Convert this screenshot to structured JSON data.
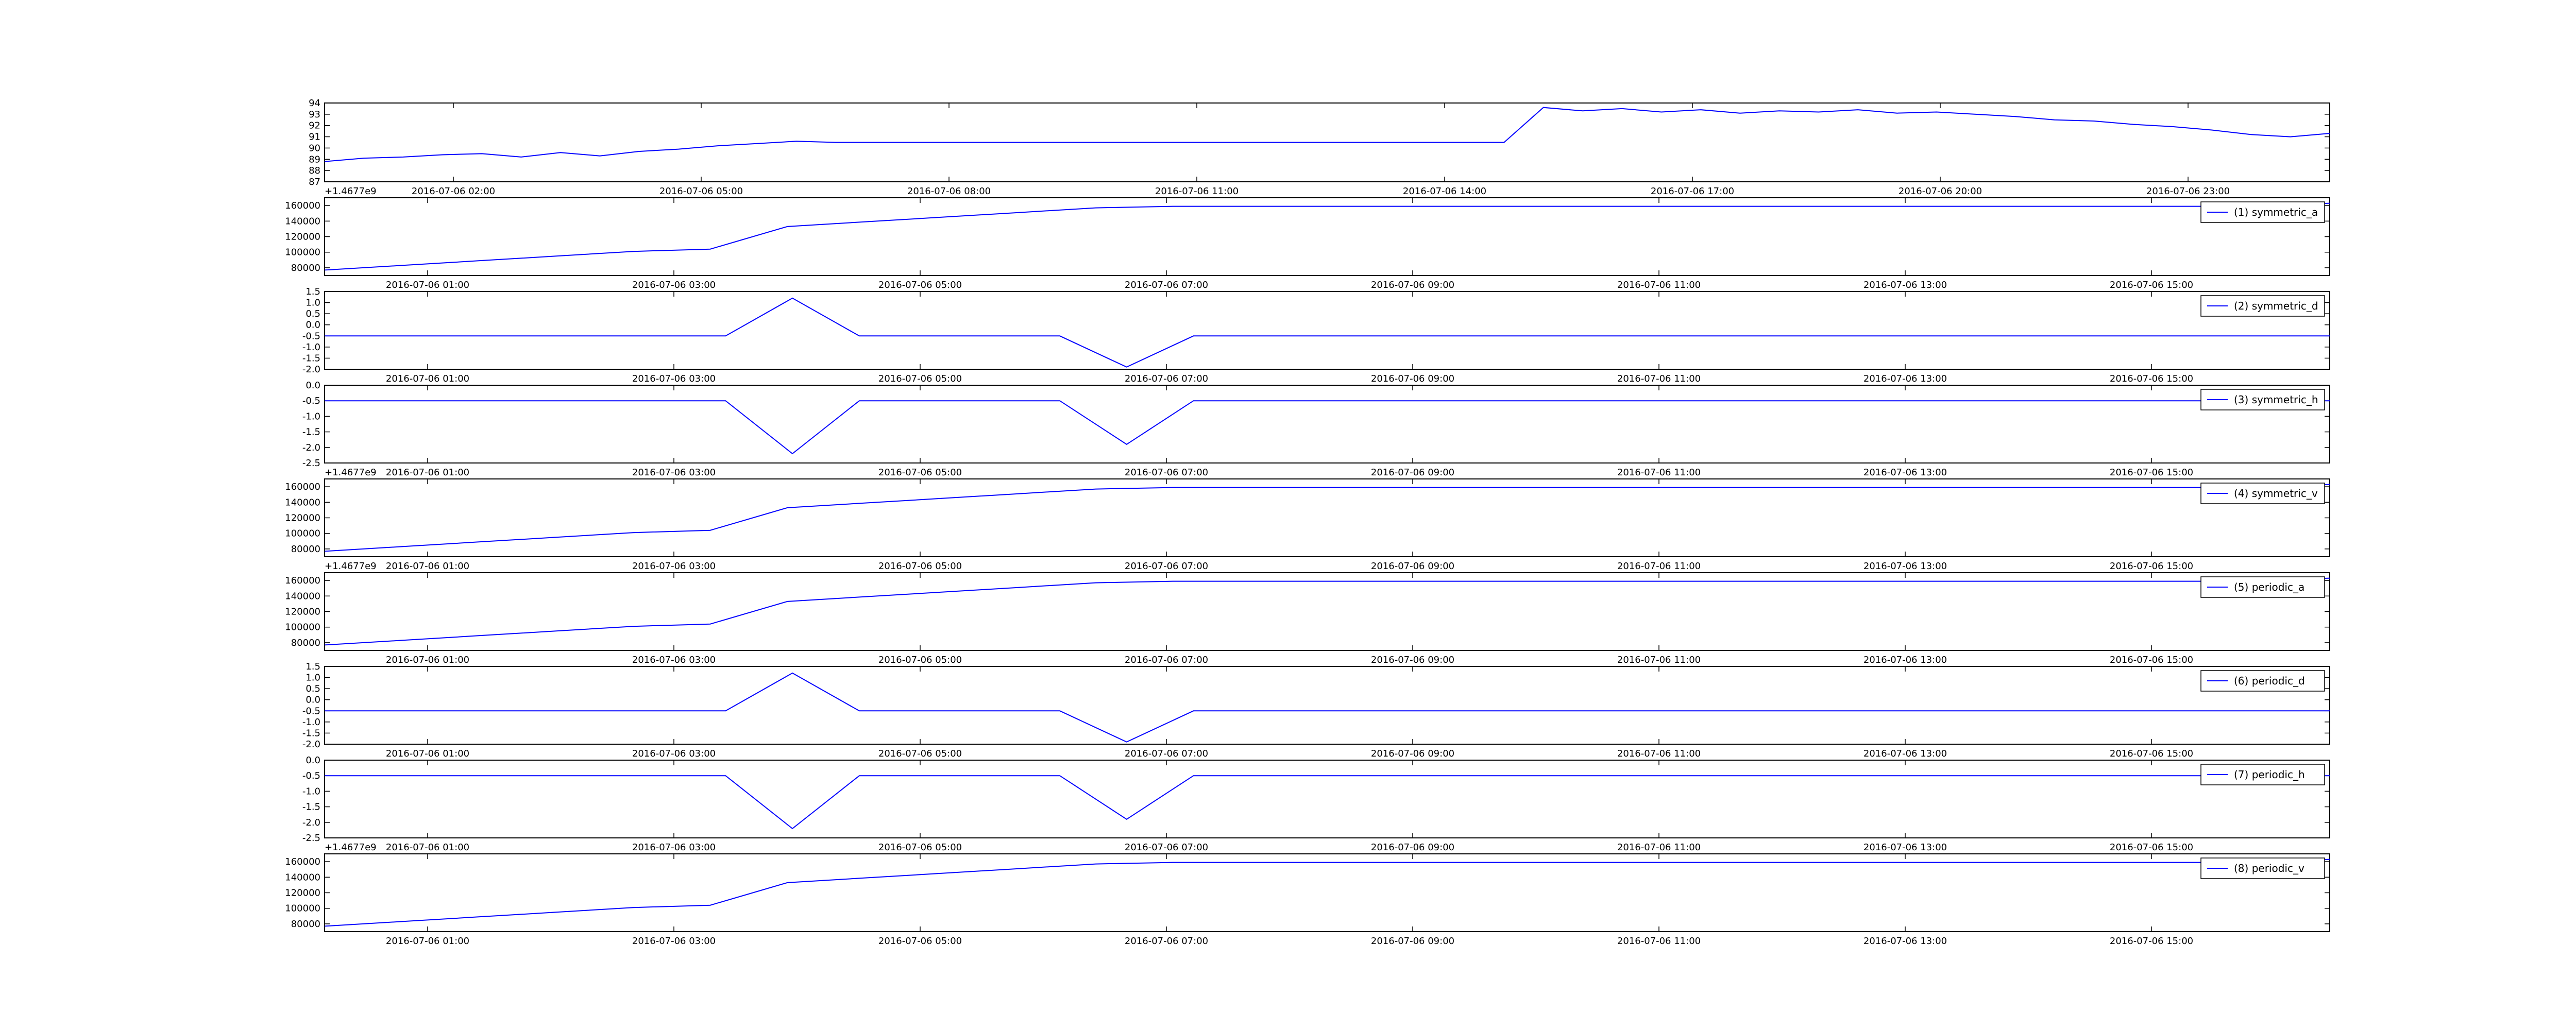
{
  "colors": {
    "line": "#0000ff",
    "axes": "#000000",
    "background": "#ffffff"
  },
  "chart_data": [
    {
      "type": "line",
      "ylim": [
        87,
        94
      ],
      "yticks": [
        "87",
        "88",
        "89",
        "90",
        "91",
        "92",
        "93",
        "94"
      ],
      "xticks": [
        "2016-07-06 02:00",
        "2016-07-06 05:00",
        "2016-07-06 08:00",
        "2016-07-06 11:00",
        "2016-07-06 14:00",
        "2016-07-06 17:00",
        "2016-07-06 20:00",
        "2016-07-06 23:00"
      ],
      "offset_text": "+1.4677e9",
      "series": [
        {
          "values": [
            88.8,
            89.1,
            89.2,
            89.4,
            89.5,
            89.2,
            89.6,
            89.3,
            89.7,
            89.9,
            90.2,
            90.4,
            90.6,
            90.5,
            90.5,
            90.5,
            90.5,
            90.5,
            90.5,
            90.5,
            90.5,
            90.5,
            90.5,
            90.5,
            90.5,
            90.5,
            90.5,
            90.5,
            90.5,
            90.5,
            90.5,
            93.6,
            93.3,
            93.5,
            93.2,
            93.4,
            93.1,
            93.3,
            93.2,
            93.4,
            93.1,
            93.2,
            93.0,
            92.8,
            92.5,
            92.4,
            92.1,
            91.9,
            91.6,
            91.2,
            91.0,
            91.3
          ]
        }
      ]
    },
    {
      "type": "line",
      "ylim": [
        70000,
        170000
      ],
      "yticks": [
        "80000",
        "100000",
        "120000",
        "140000",
        "160000"
      ],
      "xticks": [
        "2016-07-06 01:00",
        "2016-07-06 03:00",
        "2016-07-06 05:00",
        "2016-07-06 07:00",
        "2016-07-06 09:00",
        "2016-07-06 11:00",
        "2016-07-06 13:00",
        "2016-07-06 15:00"
      ],
      "offset_text": "",
      "legend": "(1) symmetric_a",
      "series": [
        {
          "name": "(1) symmetric_a",
          "values": [
            77000,
            83000,
            89000,
            95000,
            101000,
            104000,
            133000,
            139000,
            145000,
            151000,
            157000,
            159000,
            159000,
            159000,
            159000,
            159000,
            159000,
            159000,
            159000,
            159000,
            159000,
            159000,
            159000,
            159000,
            159000,
            159000,
            163000
          ]
        }
      ]
    },
    {
      "type": "line",
      "ylim": [
        -2.0,
        1.5
      ],
      "yticks": [
        "-2.0",
        "-1.5",
        "-1.0",
        "-0.5",
        "0.0",
        "0.5",
        "1.0",
        "1.5"
      ],
      "xticks": [
        "2016-07-06 01:00",
        "2016-07-06 03:00",
        "2016-07-06 05:00",
        "2016-07-06 07:00",
        "2016-07-06 09:00",
        "2016-07-06 11:00",
        "2016-07-06 13:00",
        "2016-07-06 15:00"
      ],
      "offset_text": "",
      "legend": "(2) symmetric_d",
      "series": [
        {
          "name": "(2) symmetric_d",
          "values": [
            -0.5,
            -0.5,
            -0.5,
            -0.5,
            -0.5,
            -0.5,
            -0.5,
            1.2,
            -0.5,
            -0.5,
            -0.5,
            -0.5,
            -1.9,
            -0.5,
            -0.5,
            -0.5,
            -0.5,
            -0.5,
            -0.5,
            -0.5,
            -0.5,
            -0.5,
            -0.5,
            -0.5,
            -0.5,
            -0.5,
            -0.5,
            -0.5,
            -0.5,
            -0.5,
            -0.5
          ]
        }
      ]
    },
    {
      "type": "line",
      "ylim": [
        -2.5,
        0.0
      ],
      "yticks": [
        "-2.5",
        "-2.0",
        "-1.5",
        "-1.0",
        "-0.5",
        "0.0"
      ],
      "xticks": [
        "2016-07-06 01:00",
        "2016-07-06 03:00",
        "2016-07-06 05:00",
        "2016-07-06 07:00",
        "2016-07-06 09:00",
        "2016-07-06 11:00",
        "2016-07-06 13:00",
        "2016-07-06 15:00"
      ],
      "offset_text": "+1.4677e9",
      "legend": "(3) symmetric_h",
      "series": [
        {
          "name": "(3) symmetric_h",
          "values": [
            -0.5,
            -0.5,
            -0.5,
            -0.5,
            -0.5,
            -0.5,
            -0.5,
            -2.2,
            -0.5,
            -0.5,
            -0.5,
            -0.5,
            -1.9,
            -0.5,
            -0.5,
            -0.5,
            -0.5,
            -0.5,
            -0.5,
            -0.5,
            -0.5,
            -0.5,
            -0.5,
            -0.5,
            -0.5,
            -0.5,
            -0.5,
            -0.5,
            -0.5,
            -0.5,
            -0.5
          ]
        }
      ]
    },
    {
      "type": "line",
      "ylim": [
        70000,
        170000
      ],
      "yticks": [
        "80000",
        "100000",
        "120000",
        "140000",
        "160000"
      ],
      "xticks": [
        "2016-07-06 01:00",
        "2016-07-06 03:00",
        "2016-07-06 05:00",
        "2016-07-06 07:00",
        "2016-07-06 09:00",
        "2016-07-06 11:00",
        "2016-07-06 13:00",
        "2016-07-06 15:00"
      ],
      "offset_text": "+1.4677e9",
      "legend": "(4) symmetric_v",
      "series": [
        {
          "name": "(4) symmetric_v",
          "values": [
            77000,
            83000,
            89000,
            95000,
            101000,
            104000,
            133000,
            139000,
            145000,
            151000,
            157000,
            159000,
            159000,
            159000,
            159000,
            159000,
            159000,
            159000,
            159000,
            159000,
            159000,
            159000,
            159000,
            159000,
            159000,
            159000,
            163000
          ]
        }
      ]
    },
    {
      "type": "line",
      "ylim": [
        70000,
        170000
      ],
      "yticks": [
        "80000",
        "100000",
        "120000",
        "140000",
        "160000"
      ],
      "xticks": [
        "2016-07-06 01:00",
        "2016-07-06 03:00",
        "2016-07-06 05:00",
        "2016-07-06 07:00",
        "2016-07-06 09:00",
        "2016-07-06 11:00",
        "2016-07-06 13:00",
        "2016-07-06 15:00"
      ],
      "offset_text": "",
      "legend": "(5) periodic_a",
      "series": [
        {
          "name": "(5) periodic_a",
          "values": [
            77000,
            83000,
            89000,
            95000,
            101000,
            104000,
            133000,
            139000,
            145000,
            151000,
            157000,
            159000,
            159000,
            159000,
            159000,
            159000,
            159000,
            159000,
            159000,
            159000,
            159000,
            159000,
            159000,
            159000,
            159000,
            159000,
            163000
          ]
        }
      ]
    },
    {
      "type": "line",
      "ylim": [
        -2.0,
        1.5
      ],
      "yticks": [
        "-2.0",
        "-1.5",
        "-1.0",
        "-0.5",
        "0.0",
        "0.5",
        "1.0",
        "1.5"
      ],
      "xticks": [
        "2016-07-06 01:00",
        "2016-07-06 03:00",
        "2016-07-06 05:00",
        "2016-07-06 07:00",
        "2016-07-06 09:00",
        "2016-07-06 11:00",
        "2016-07-06 13:00",
        "2016-07-06 15:00"
      ],
      "offset_text": "",
      "legend": "(6) periodic_d",
      "series": [
        {
          "name": "(6) periodic_d",
          "values": [
            -0.5,
            -0.5,
            -0.5,
            -0.5,
            -0.5,
            -0.5,
            -0.5,
            1.2,
            -0.5,
            -0.5,
            -0.5,
            -0.5,
            -1.9,
            -0.5,
            -0.5,
            -0.5,
            -0.5,
            -0.5,
            -0.5,
            -0.5,
            -0.5,
            -0.5,
            -0.5,
            -0.5,
            -0.5,
            -0.5,
            -0.5,
            -0.5,
            -0.5,
            -0.5,
            -0.5
          ]
        }
      ]
    },
    {
      "type": "line",
      "ylim": [
        -2.5,
        0.0
      ],
      "yticks": [
        "-2.5",
        "-2.0",
        "-1.5",
        "-1.0",
        "-0.5",
        "0.0"
      ],
      "xticks": [
        "2016-07-06 01:00",
        "2016-07-06 03:00",
        "2016-07-06 05:00",
        "2016-07-06 07:00",
        "2016-07-06 09:00",
        "2016-07-06 11:00",
        "2016-07-06 13:00",
        "2016-07-06 15:00"
      ],
      "offset_text": "+1.4677e9",
      "legend": "(7) periodic_h",
      "series": [
        {
          "name": "(7) periodic_h",
          "values": [
            -0.5,
            -0.5,
            -0.5,
            -0.5,
            -0.5,
            -0.5,
            -0.5,
            -2.2,
            -0.5,
            -0.5,
            -0.5,
            -0.5,
            -1.9,
            -0.5,
            -0.5,
            -0.5,
            -0.5,
            -0.5,
            -0.5,
            -0.5,
            -0.5,
            -0.5,
            -0.5,
            -0.5,
            -0.5,
            -0.5,
            -0.5,
            -0.5,
            -0.5,
            -0.5,
            -0.5
          ]
        }
      ]
    },
    {
      "type": "line",
      "ylim": [
        70000,
        170000
      ],
      "yticks": [
        "80000",
        "100000",
        "120000",
        "140000",
        "160000"
      ],
      "xticks": [
        "2016-07-06 01:00",
        "2016-07-06 03:00",
        "2016-07-06 05:00",
        "2016-07-06 07:00",
        "2016-07-06 09:00",
        "2016-07-06 11:00",
        "2016-07-06 13:00",
        "2016-07-06 15:00"
      ],
      "offset_text": "",
      "legend": "(8) periodic_v",
      "series": [
        {
          "name": "(8) periodic_v",
          "values": [
            77000,
            83000,
            89000,
            95000,
            101000,
            104000,
            133000,
            139000,
            145000,
            151000,
            157000,
            159000,
            159000,
            159000,
            159000,
            159000,
            159000,
            159000,
            159000,
            159000,
            159000,
            159000,
            159000,
            159000,
            159000,
            159000,
            163000
          ]
        }
      ]
    }
  ]
}
